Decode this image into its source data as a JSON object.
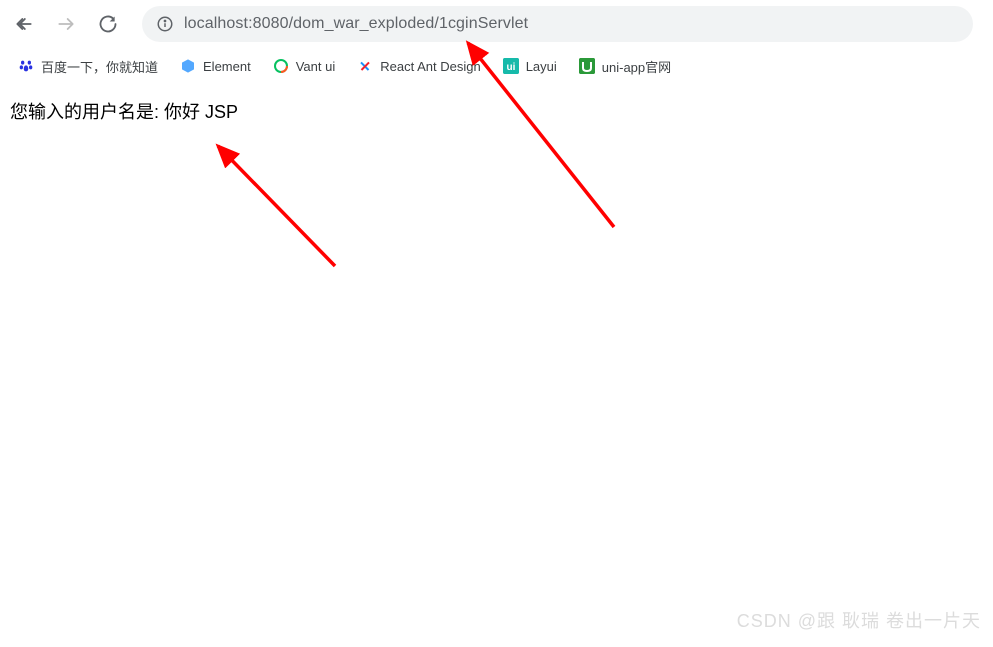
{
  "toolbar": {
    "url_host": "localhost",
    "url_port": ":8080",
    "url_path": "/dom_war_exploded/1cginServlet"
  },
  "bookmarks": [
    {
      "label": "百度一下，你就知道",
      "icon": "baidu"
    },
    {
      "label": "Element",
      "icon": "element"
    },
    {
      "label": "Vant ui",
      "icon": "vant"
    },
    {
      "label": "React Ant Design",
      "icon": "react"
    },
    {
      "label": "Layui",
      "icon": "layui"
    },
    {
      "label": "uni-app官网",
      "icon": "uniapp"
    }
  ],
  "content": {
    "message": "您输入的用户名是: 你好 JSP"
  },
  "watermark": "CSDN @跟 耿瑞 卷出一片天"
}
